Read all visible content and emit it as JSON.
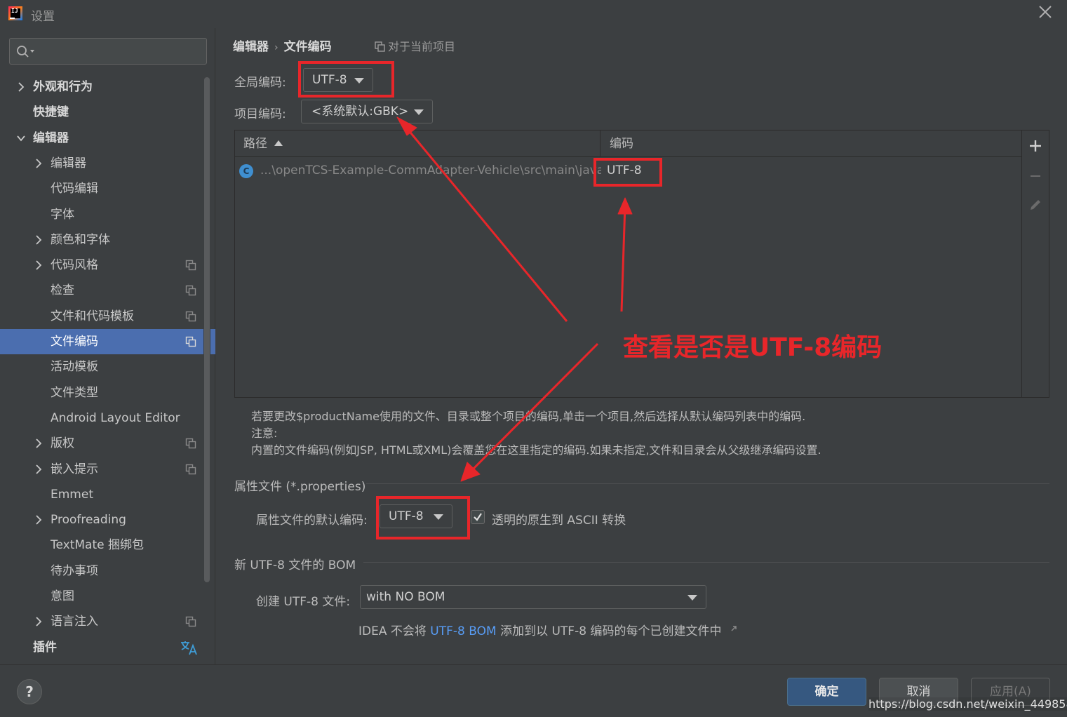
{
  "window": {
    "title": "设置"
  },
  "sidebar": {
    "items": [
      {
        "label": "外观和行为",
        "level": 0,
        "bold": true,
        "chevron": "right",
        "project": false
      },
      {
        "label": "快捷键",
        "level": 0,
        "bold": true,
        "chevron": "none",
        "project": false
      },
      {
        "label": "编辑器",
        "level": 0,
        "bold": true,
        "chevron": "down",
        "project": false
      },
      {
        "label": "编辑器",
        "level": 1,
        "bold": false,
        "chevron": "right",
        "project": false
      },
      {
        "label": "代码编辑",
        "level": 1,
        "bold": false,
        "chevron": "none",
        "project": false
      },
      {
        "label": "字体",
        "level": 1,
        "bold": false,
        "chevron": "none",
        "project": false
      },
      {
        "label": "颜色和字体",
        "level": 1,
        "bold": false,
        "chevron": "right",
        "project": false
      },
      {
        "label": "代码风格",
        "level": 1,
        "bold": false,
        "chevron": "right",
        "project": true
      },
      {
        "label": "检查",
        "level": 1,
        "bold": false,
        "chevron": "none",
        "project": true
      },
      {
        "label": "文件和代码模板",
        "level": 1,
        "bold": false,
        "chevron": "none",
        "project": true
      },
      {
        "label": "文件编码",
        "level": 1,
        "bold": false,
        "chevron": "none",
        "project": true,
        "selected": true
      },
      {
        "label": "活动模板",
        "level": 1,
        "bold": false,
        "chevron": "none",
        "project": false
      },
      {
        "label": "文件类型",
        "level": 1,
        "bold": false,
        "chevron": "none",
        "project": false
      },
      {
        "label": "Android Layout Editor",
        "level": 1,
        "bold": false,
        "chevron": "none",
        "project": false
      },
      {
        "label": "版权",
        "level": 1,
        "bold": false,
        "chevron": "right",
        "project": true
      },
      {
        "label": "嵌入提示",
        "level": 1,
        "bold": false,
        "chevron": "right",
        "project": true
      },
      {
        "label": "Emmet",
        "level": 1,
        "bold": false,
        "chevron": "none",
        "project": false
      },
      {
        "label": "Proofreading",
        "level": 1,
        "bold": false,
        "chevron": "right",
        "project": false
      },
      {
        "label": "TextMate 捆绑包",
        "level": 1,
        "bold": false,
        "chevron": "none",
        "project": false
      },
      {
        "label": "待办事项",
        "level": 1,
        "bold": false,
        "chevron": "none",
        "project": false
      },
      {
        "label": "意图",
        "level": 1,
        "bold": false,
        "chevron": "none",
        "project": false
      },
      {
        "label": "语言注入",
        "level": 1,
        "bold": false,
        "chevron": "right",
        "project": true
      },
      {
        "label": "插件",
        "level": 0,
        "bold": true,
        "chevron": "none",
        "project": false,
        "translate": true
      }
    ]
  },
  "main": {
    "breadcrumb": {
      "parent": "编辑器",
      "separator": "›",
      "current": "文件编码"
    },
    "scope_note": "对于当前项目",
    "global_encoding": {
      "label": "全局编码:",
      "value": "UTF-8"
    },
    "project_encoding": {
      "label": "项目编码:",
      "value": "<系统默认:GBK>"
    },
    "table": {
      "col_path": "路径",
      "col_encoding": "编码",
      "rows": [
        {
          "icon": "C",
          "path": "...\\openTCS-Example-CommAdapter-Vehicle\\src\\main\\java",
          "encoding": "UTF-8"
        }
      ]
    },
    "hint_lines": [
      "若要更改$productName使用的文件、目录或整个项目的编码,单击一个项目,然后选择从默认编码列表中的编码.",
      "注意:",
      "内置的文件编码(例如JSP, HTML或XML)会覆盖您在这里指定的编码.如果未指定,文件和目录会从父级继承编码设置."
    ],
    "properties_section": {
      "title": "属性文件 (*.properties)",
      "default_label": "属性文件的默认编码:",
      "default_value": "UTF-8",
      "transparent_checked": true,
      "transparent_label": "透明的原生到 ASCII 转换"
    },
    "bom_section": {
      "title": "新 UTF-8 文件的 BOM",
      "create_label": "创建 UTF-8 文件:",
      "create_value": "with NO BOM",
      "note_prefix": "IDEA 不会将 ",
      "note_link": "UTF-8 BOM",
      "note_suffix": " 添加到以 UTF-8 编码的每个已创建文件中"
    }
  },
  "annotation": {
    "text": "查看是否是UTF-8编码",
    "color": "#e8262a"
  },
  "footer": {
    "help": "?",
    "ok": "确定",
    "cancel": "取消",
    "apply": "应用(A)",
    "watermark": "https://blog.csdn.net/weixin_44985880"
  },
  "colors": {
    "accent": "#4b6eaf",
    "link": "#589df6",
    "annotation": "#e8262a",
    "primary_button": "#365880"
  }
}
